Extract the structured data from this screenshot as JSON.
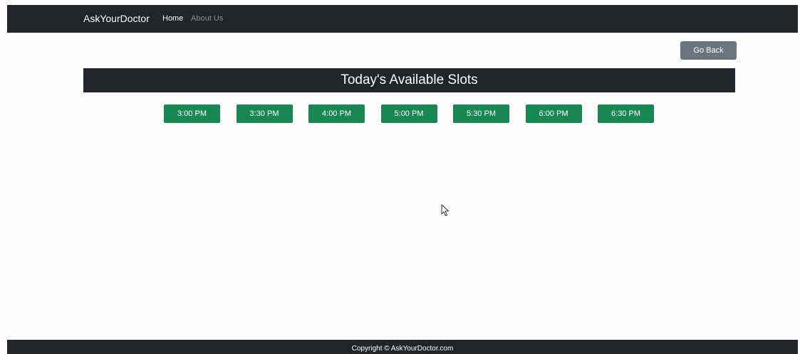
{
  "navbar": {
    "brand": "AskYourDoctor",
    "links": [
      {
        "label": "Home"
      },
      {
        "label": "About Us"
      }
    ]
  },
  "actions": {
    "back_label": "Go Back"
  },
  "main": {
    "heading": "Today's Available Slots",
    "slots": [
      "3:00 PM",
      "3:30 PM",
      "4:00 PM",
      "5:00 PM",
      "5:30 PM",
      "6:00 PM",
      "6:30 PM"
    ]
  },
  "footer": {
    "copyright": "Copyright © AskYourDoctor.com"
  },
  "colors": {
    "navbar_bg": "#212529",
    "slot_button": "#198754",
    "back_button": "#6c757d"
  },
  "icons": {
    "cursor": "mouse-pointer-icon"
  }
}
